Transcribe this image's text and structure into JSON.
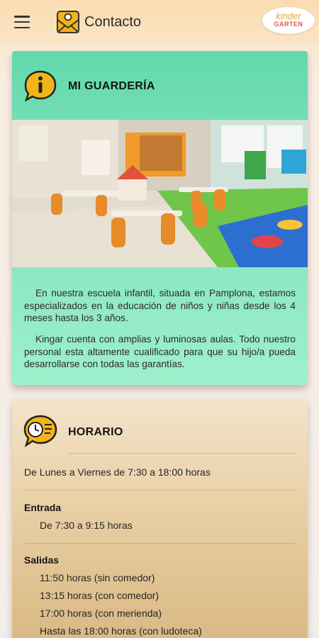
{
  "appbar": {
    "title": "Contacto",
    "logo_line1": "kinder",
    "logo_line2": "GARTEN"
  },
  "guarderia": {
    "title": "MI GUARDERÍA",
    "paragraph1": "En nuestra escuela infantil, situada en Pamplona, estamos especializados en la educación de niños y niñas desde los 4 meses hasta los 3 años.",
    "paragraph2": "Kingar cuenta con amplias y luminosas aulas. Todo nuestro personal esta altamente cualificado para que su hijo/a pueda desarrollarse con todas las garantías."
  },
  "horario": {
    "title": "HORARIO",
    "general": "De Lunes a Viernes de 7:30 a 18:00 horas",
    "entrada_label": "Entrada",
    "entrada_time": "De 7:30 a 9:15 horas",
    "salidas_label": "Salidas",
    "salidas": [
      "11:50 horas (sin comedor)",
      "13:15 horas (con comedor)",
      "17:00 horas (con merienda)",
      "Hasta las 18:00 horas (con ludoteca)"
    ]
  },
  "colors": {
    "card1_accent": "#62d9ac",
    "card2_accent": "#d8b680",
    "icon_yellow": "#f2b418"
  },
  "icons": [
    "menu-icon",
    "envelope-icon",
    "info-icon",
    "clock-icon"
  ]
}
